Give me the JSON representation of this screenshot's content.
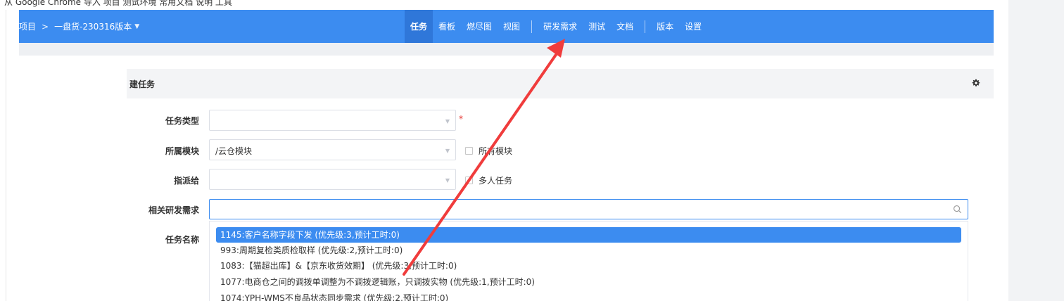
{
  "bookmarks": {
    "text": "从 Google Chrome 导入 项目 测试环境 常用文档 说明 工具"
  },
  "breadcrumb": {
    "root": "项目",
    "separator": ">",
    "current": "一盘货-230316版本"
  },
  "nav": {
    "items": [
      "任务",
      "看板",
      "燃尽图",
      "视图",
      "研发需求",
      "测试",
      "文档",
      "版本",
      "设置"
    ],
    "active": "任务"
  },
  "form": {
    "title": "建任务",
    "task_type_label": "任务类型",
    "task_type_value": "",
    "required_mark": "*",
    "module_label": "所属模块",
    "module_value": "/云仓模块",
    "all_modules_label": "所有模块",
    "assignee_label": "指派给",
    "assignee_value": "",
    "multi_task_label": "多人任务",
    "story_label": "相关研发需求",
    "story_search_value": "",
    "name_label": "任务名称"
  },
  "story_options": [
    "1145:客户名称字段下发 (优先级:3,预计工时:0)",
    "993:周期复检类质检取样 (优先级:2,预计工时:0)",
    "1083:【猫超出库】&【京东收货效期】 (优先级:3,预计工时:0)",
    "1077:电商仓之间的调拨单调整为不调拨逻辑账，只调拨实物 (优先级:1,预计工时:0)",
    "1074:YPH-WMS不良品状态同步需求 (优先级:2,预计工时:0)"
  ],
  "colors": {
    "primary": "#3c8cf0",
    "annotation_arrow": "#f03c3c"
  }
}
